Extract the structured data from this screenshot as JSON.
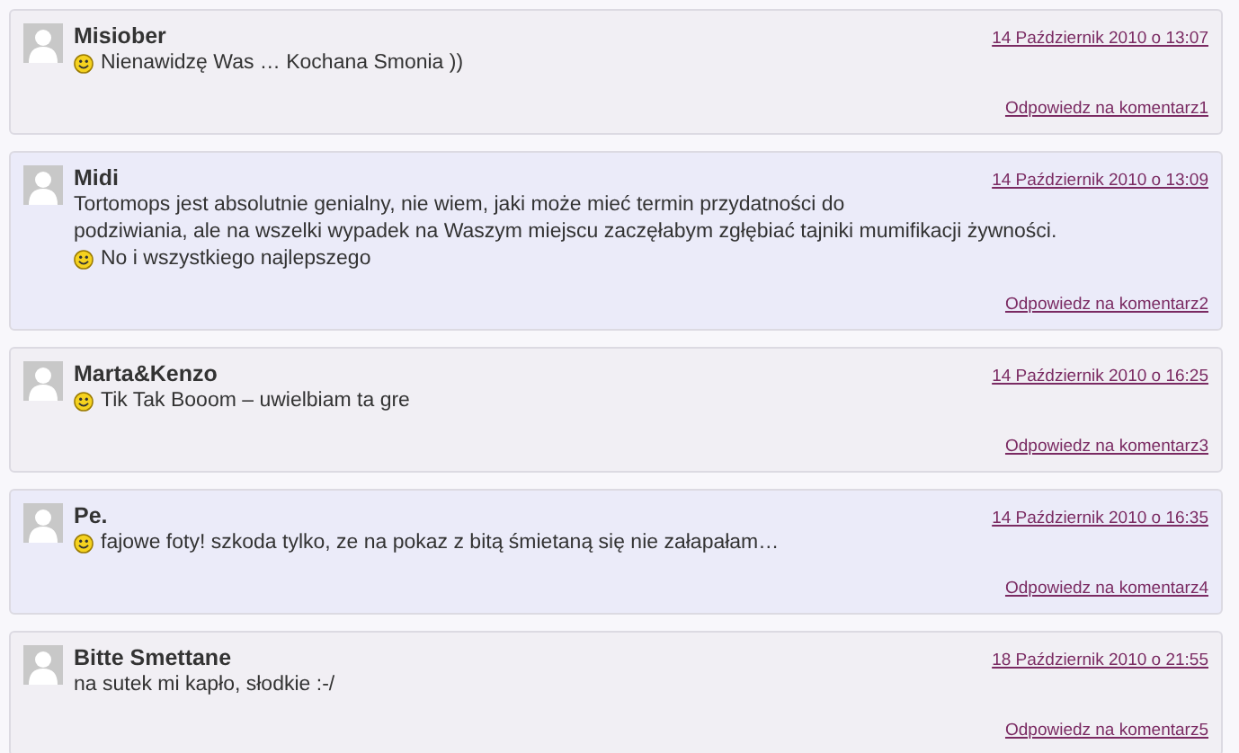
{
  "comments": [
    {
      "color": "#f1eff4",
      "author": "Misiober",
      "date": "14 Październik 2010 o 13:07",
      "lines": [
        {
          "smiley": true,
          "text": "Nienawidzę Was … Kochana Smonia ))"
        }
      ],
      "reply": "Odpowiedz na komentarz1"
    },
    {
      "color": "#ebebf9",
      "author": "Midi",
      "date": "14 Październik 2010 o 13:09",
      "lines": [
        {
          "smiley": false,
          "text": "Tortomops jest absolutnie genialny, nie wiem, jaki może mieć termin przydatności do"
        },
        {
          "smiley": false,
          "text": "podziwiania, ale na wszelki wypadek na Waszym miejscu zaczęłabym zgłębiać tajniki mumifikacji żywności."
        },
        {
          "smiley": true,
          "text": "No i wszystkiego najlepszego"
        }
      ],
      "reply": "Odpowiedz na komentarz2"
    },
    {
      "color": "#f1eff4",
      "author": "Marta&Kenzo",
      "date": "14 Październik 2010 o 16:25",
      "lines": [
        {
          "smiley": true,
          "text": "Tik Tak Booom – uwielbiam ta gre"
        }
      ],
      "reply": "Odpowiedz na komentarz3"
    },
    {
      "color": "#ebebf9",
      "author": "Pe.",
      "date": "14 Październik 2010 o 16:35",
      "lines": [
        {
          "smiley": true,
          "text": "fajowe foty! szkoda tylko, ze na pokaz z bitą śmietaną się nie załapałam…"
        }
      ],
      "reply": "Odpowiedz na komentarz4"
    },
    {
      "color": "#f1eff4",
      "author": "Bitte Smettane",
      "date": "18 Październik 2010 o 21:55",
      "lines": [
        {
          "smiley": false,
          "text": "na sutek mi kapło, słodkie :-/"
        }
      ],
      "reply": "Odpowiedz na komentarz5"
    }
  ]
}
